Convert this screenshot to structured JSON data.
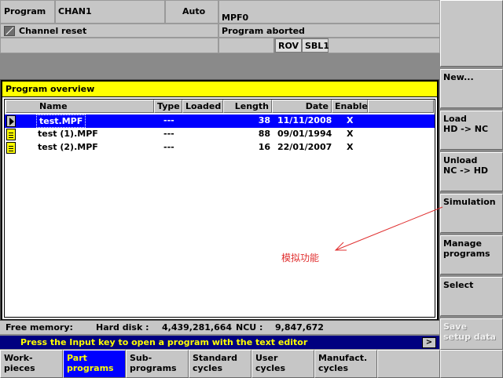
{
  "status": {
    "mode": "Program",
    "channel": "CHAN1",
    "operating_mode": "Auto",
    "program_name": "MPF0",
    "channel_state": "Channel reset",
    "program_state": "Program aborted",
    "flags": [
      "ROV",
      "SBL1"
    ]
  },
  "window": {
    "title": "Program overview",
    "columns": [
      "Name",
      "Type",
      "Loaded",
      "Length",
      "Date",
      "Enable"
    ],
    "files": [
      {
        "name": "test.MPF",
        "type": "---",
        "loaded": "",
        "length": "38",
        "date": "11/11/2008",
        "enable": "X"
      },
      {
        "name": "test (1).MPF",
        "type": "---",
        "loaded": "",
        "length": "88",
        "date": "09/01/1994",
        "enable": "X"
      },
      {
        "name": "test (2).MPF",
        "type": "---",
        "loaded": "",
        "length": "16",
        "date": "22/01/2007",
        "enable": "X"
      }
    ],
    "selected_row": 0
  },
  "memory": {
    "label": "Free memory:",
    "hard_disk_label": "Hard disk :",
    "hard_disk_value": "4,439,281,664",
    "ncu_label": "NCU :",
    "ncu_value": "9,847,672"
  },
  "info": {
    "message": "Press the Input key to open a program with the text editor",
    "more_button": ">"
  },
  "horizontal_softkeys": [
    {
      "label": "Work-\npieces",
      "active": false
    },
    {
      "label": "Part\nprograms",
      "active": true
    },
    {
      "label": "Sub-\nprograms",
      "active": false
    },
    {
      "label": "Standard\ncycles",
      "active": false
    },
    {
      "label": "User\ncycles",
      "active": false
    },
    {
      "label": "Manufact.\ncycles",
      "active": false
    },
    {
      "label": "",
      "active": false
    },
    {
      "label": "",
      "active": false
    }
  ],
  "vertical_softkeys": [
    {
      "label": "",
      "enabled": true
    },
    {
      "label": "New...",
      "enabled": true
    },
    {
      "label": "Load\nHD -> NC",
      "enabled": true
    },
    {
      "label": "Unload\nNC -> HD",
      "enabled": true
    },
    {
      "label": "Simulation",
      "enabled": true
    },
    {
      "label": "Manage\nprograms",
      "enabled": true
    },
    {
      "label": "Select",
      "enabled": true
    },
    {
      "label": "Save\nsetup data",
      "enabled": false
    }
  ],
  "annotation": {
    "text": "模拟功能",
    "color": "#e03030"
  },
  "colors": {
    "selection": "#0000ff",
    "title_bar": "#ffff00",
    "info_background": "#000080",
    "info_text": "#ffff00"
  }
}
